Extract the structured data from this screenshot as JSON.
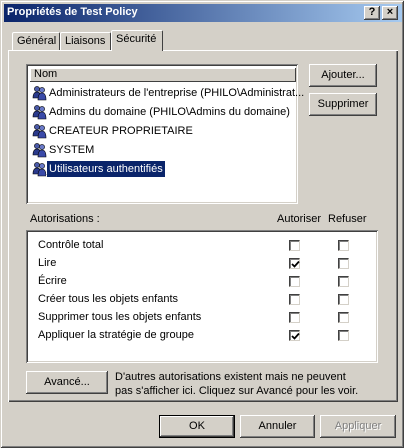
{
  "window": {
    "title": "Propriétés de Test Policy",
    "help_button": "?",
    "close_button": "×"
  },
  "tabs": [
    {
      "label": "Général",
      "active": false
    },
    {
      "label": "Liaisons",
      "active": false
    },
    {
      "label": "Sécurité",
      "active": true
    }
  ],
  "principals": {
    "column_header": "Nom",
    "items": [
      {
        "label": "Administrateurs de l'entreprise (PHILO\\Administrat...",
        "selected": false
      },
      {
        "label": "Admins du domaine (PHILO\\Admins du domaine)",
        "selected": false
      },
      {
        "label": "CREATEUR PROPRIETAIRE",
        "selected": false
      },
      {
        "label": "SYSTEM",
        "selected": false
      },
      {
        "label": "Utilisateurs authentifiés",
        "selected": true
      }
    ]
  },
  "buttons": {
    "add": "Ajouter...",
    "remove": "Supprimer",
    "advanced": "Avancé...",
    "ok": "OK",
    "cancel": "Annuler",
    "apply": "Appliquer"
  },
  "permissions": {
    "section_label": "Autorisations :",
    "allow_header": "Autoriser",
    "deny_header": "Refuser",
    "rows": [
      {
        "label": "Contrôle total",
        "allow": false,
        "deny": false
      },
      {
        "label": "Lire",
        "allow": true,
        "deny": false
      },
      {
        "label": "Écrire",
        "allow": false,
        "deny": false
      },
      {
        "label": "Créer tous les objets enfants",
        "allow": false,
        "deny": false
      },
      {
        "label": "Supprimer tous les objets enfants",
        "allow": false,
        "deny": false
      },
      {
        "label": "Appliquer la stratégie de groupe",
        "allow": true,
        "deny": false
      }
    ]
  },
  "advanced_note": {
    "line1": "D'autres autorisations existent mais ne peuvent",
    "line2": "pas s'afficher ici. Cliquez sur Avancé pour les voir."
  },
  "colors": {
    "title_start": "#0a246a",
    "title_end": "#a6caf0",
    "face": "#d4d0c8",
    "selection": "#0a246a"
  }
}
